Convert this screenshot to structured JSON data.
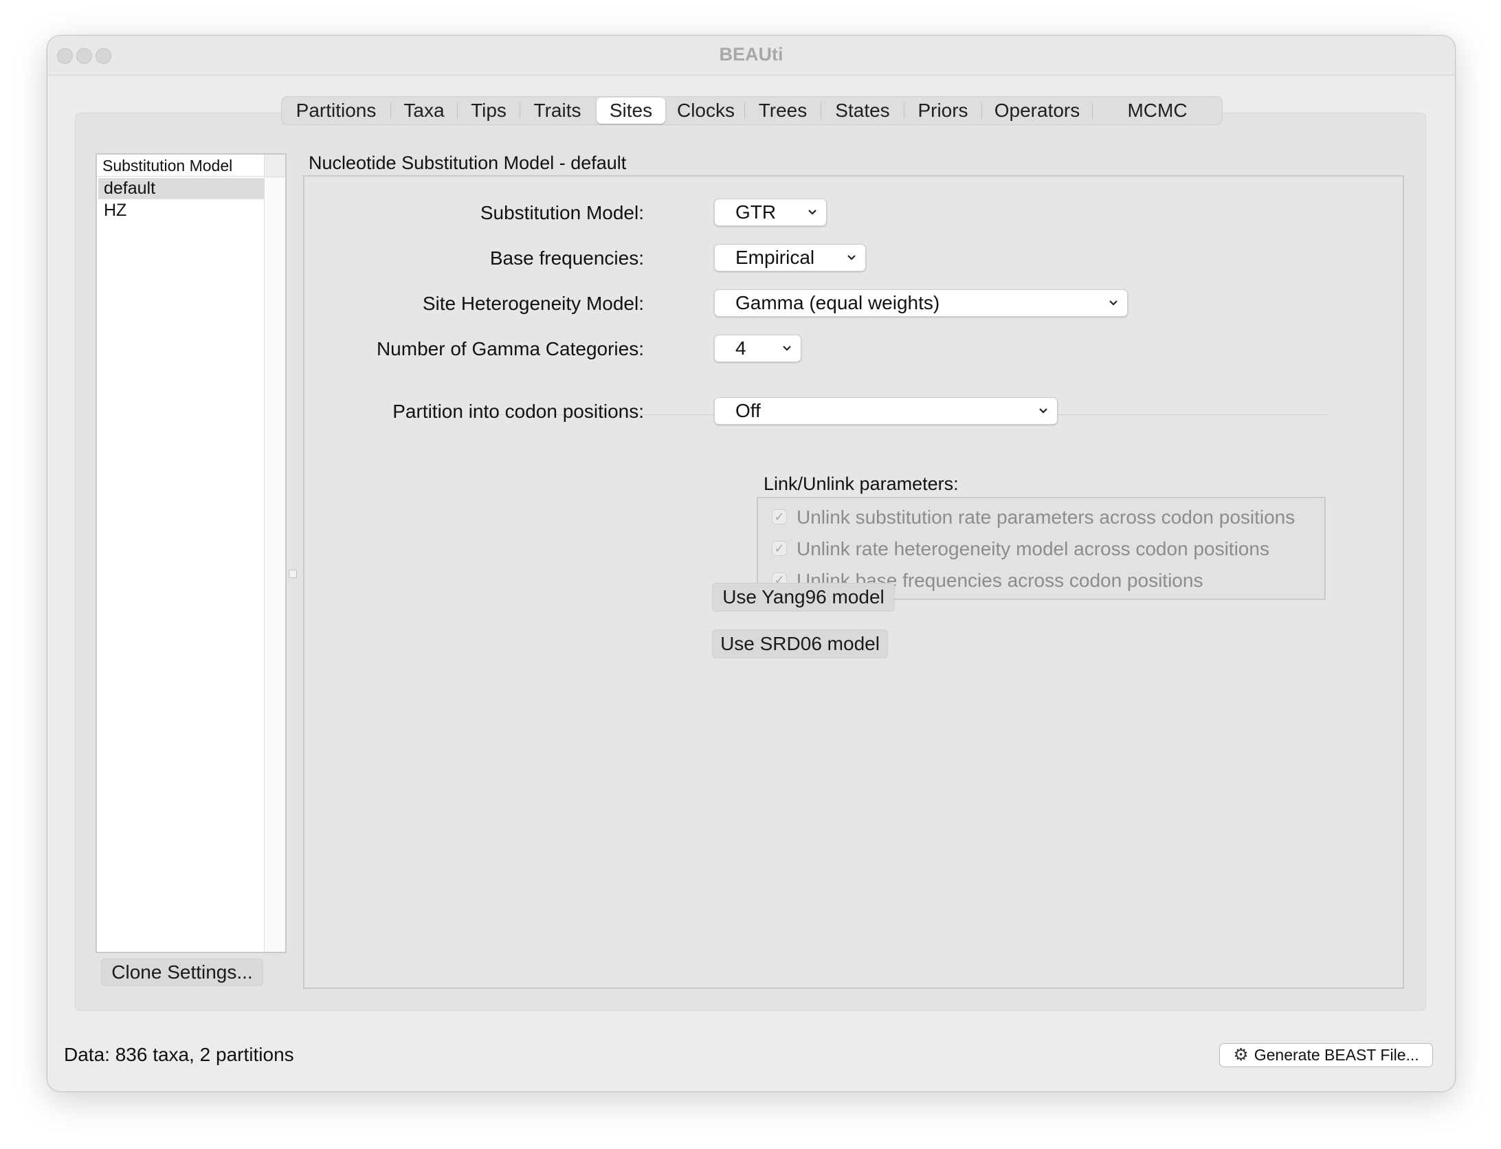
{
  "window": {
    "title": "BEAUti"
  },
  "tabs": [
    {
      "label": "Partitions",
      "selected": false
    },
    {
      "label": "Taxa",
      "selected": false
    },
    {
      "label": "Tips",
      "selected": false
    },
    {
      "label": "Traits",
      "selected": false
    },
    {
      "label": "Sites",
      "selected": true
    },
    {
      "label": "Clocks",
      "selected": false
    },
    {
      "label": "Trees",
      "selected": false
    },
    {
      "label": "States",
      "selected": false
    },
    {
      "label": "Priors",
      "selected": false
    },
    {
      "label": "Operators",
      "selected": false
    },
    {
      "label": "MCMC",
      "selected": false
    }
  ],
  "model_list": {
    "header": "Substitution Model",
    "items": [
      {
        "label": "default",
        "selected": true
      },
      {
        "label": "HZ",
        "selected": false
      }
    ],
    "clone_button": "Clone Settings..."
  },
  "panel": {
    "title": "Nucleotide Substitution Model - default",
    "substitution_model": {
      "label": "Substitution Model:",
      "value": "GTR"
    },
    "base_frequencies": {
      "label": "Base frequencies:",
      "value": "Empirical"
    },
    "site_heterogeneity": {
      "label": "Site Heterogeneity Model:",
      "value": "Gamma (equal weights)"
    },
    "gamma_categories": {
      "label": "Number of Gamma Categories:",
      "value": "4"
    },
    "codon_partition": {
      "label": "Partition into codon positions:",
      "value": "Off"
    },
    "link_unlink": {
      "label": "Link/Unlink parameters:",
      "options": [
        {
          "label": "Unlink substitution rate parameters across codon positions",
          "checked": true,
          "enabled": false
        },
        {
          "label": "Unlink rate heterogeneity model across codon positions",
          "checked": true,
          "enabled": false
        },
        {
          "label": "Unlink base frequencies across codon positions",
          "checked": true,
          "enabled": false
        }
      ]
    },
    "yang96_button": "Use Yang96 model",
    "srd06_button": "Use SRD06 model"
  },
  "status": {
    "text": "Data: 836 taxa, 2 partitions"
  },
  "generate_button": {
    "label": "Generate BEAST File...",
    "icon": "gear-icon"
  },
  "colors": {
    "window_bg": "#ececec",
    "selected_row": "#dcdcdc",
    "disabled_text": "#8c8c8c"
  }
}
